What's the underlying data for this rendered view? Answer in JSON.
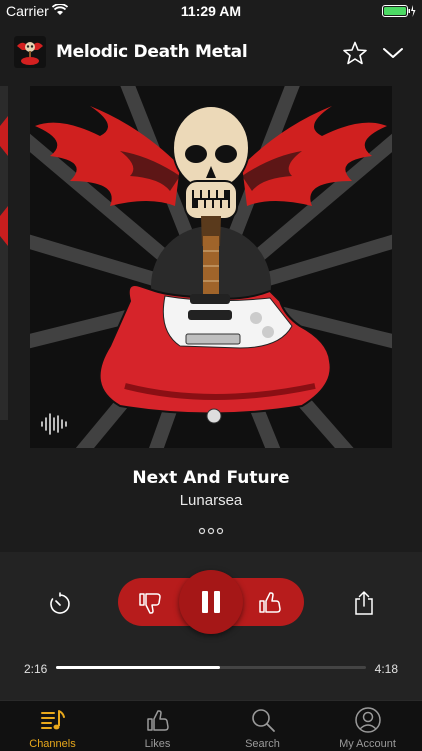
{
  "status_bar": {
    "carrier": "Carrier",
    "time": "11:29 AM"
  },
  "header": {
    "title": "Melodic Death Metal"
  },
  "track": {
    "title": "Next And Future",
    "artist": "Lunarsea"
  },
  "player": {
    "elapsed": "2:16",
    "total": "4:18",
    "progress": 0.53
  },
  "tabs": [
    {
      "label": "Channels",
      "icon": "channels-icon",
      "active": true
    },
    {
      "label": "Likes",
      "icon": "likes-icon"
    },
    {
      "label": "Search",
      "icon": "search-icon"
    },
    {
      "label": "My Account",
      "icon": "account-icon"
    }
  ],
  "colors": {
    "accent": "#e8a81c",
    "player_red": "#b71c1c",
    "background": "#1c1c1c"
  }
}
